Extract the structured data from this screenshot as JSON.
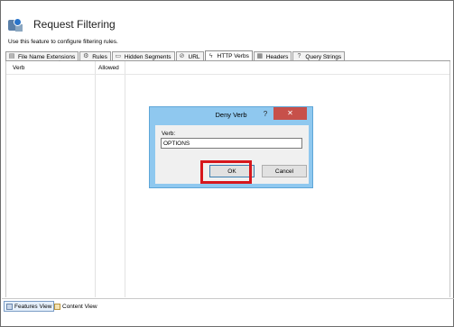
{
  "header": {
    "title": "Request Filtering",
    "icon": "request-filtering-icon"
  },
  "description": "Use this feature to configure filtering rules.",
  "tabs": [
    {
      "label": "File Name Extensions",
      "icon": "file-icon",
      "active": false
    },
    {
      "label": "Rules",
      "icon": "rules-icon",
      "active": false
    },
    {
      "label": "Hidden Segments",
      "icon": "hidden-segments-icon",
      "active": false
    },
    {
      "label": "URL",
      "icon": "url-icon",
      "active": false
    },
    {
      "label": "HTTP Verbs",
      "icon": "http-verbs-icon",
      "active": true
    },
    {
      "label": "Headers",
      "icon": "headers-icon",
      "active": false
    },
    {
      "label": "Query Strings",
      "icon": "query-strings-icon",
      "active": false
    }
  ],
  "list": {
    "columns": [
      "Verb",
      "Allowed"
    ]
  },
  "dialog": {
    "title": "Deny Verb",
    "help": "?",
    "close": "✕",
    "field_label": "Verb:",
    "field_value": "OPTIONS",
    "ok_label": "OK",
    "cancel_label": "Cancel"
  },
  "views": [
    {
      "label": "Features View",
      "active": true
    },
    {
      "label": "Content View",
      "active": false
    }
  ],
  "colors": {
    "highlight": "#d6171d",
    "dialog_frame": "#8fc8ef",
    "close_button": "#c7504a"
  }
}
